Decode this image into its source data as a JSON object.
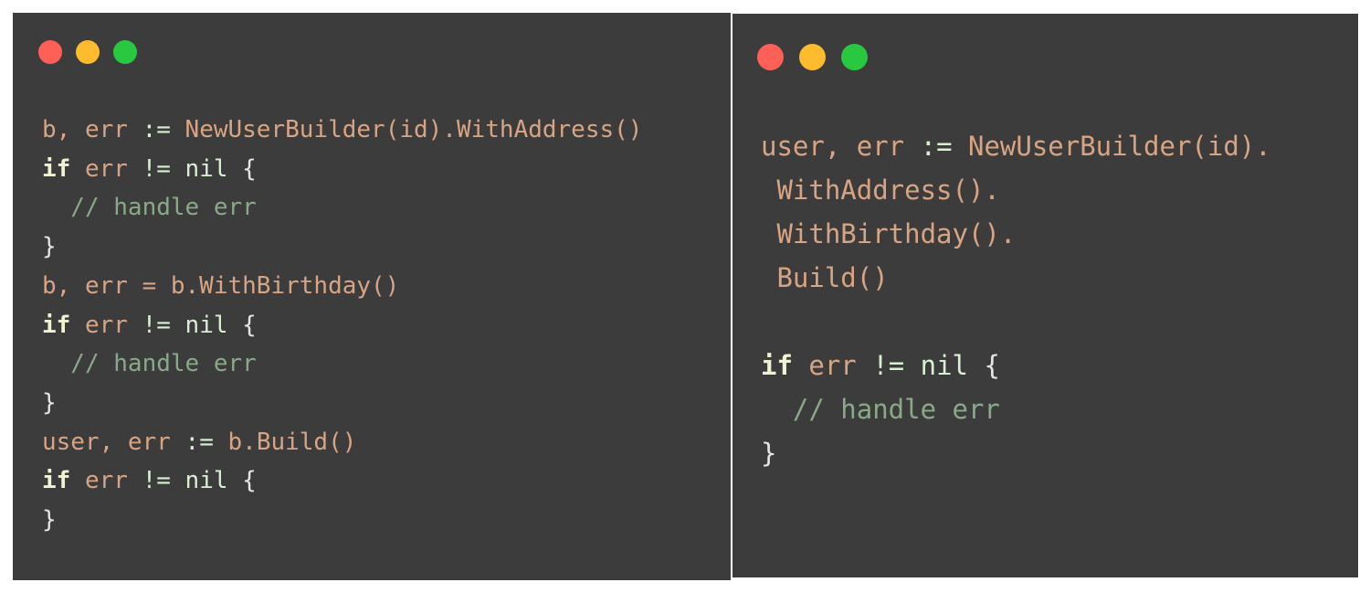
{
  "colors": {
    "window_bg": "#3c3c3c",
    "dot_red": "#fe5f57",
    "dot_yellow": "#fdbb2e",
    "dot_green": "#28c840",
    "identifier": "#d8a483",
    "keyword": "#f1f1d4",
    "operator": "#d8efd2",
    "comment": "#8aa989"
  },
  "windows": [
    {
      "id": "left",
      "lines": [
        [
          {
            "t": "b, err ",
            "k": "id"
          },
          {
            "t": ":=",
            "k": "op"
          },
          {
            "t": " NewUserBuilder(id).WithAddress()",
            "k": "id"
          }
        ],
        [
          {
            "t": "if",
            "k": "kw"
          },
          {
            "t": " err ",
            "k": "id"
          },
          {
            "t": "!=",
            "k": "op"
          },
          {
            "t": " nil",
            "k": "op"
          },
          {
            "t": " {",
            "k": "pn"
          }
        ],
        [
          {
            "t": "  // handle err",
            "k": "cm"
          }
        ],
        [
          {
            "t": "}",
            "k": "pn"
          }
        ],
        [
          {
            "t": "b, err = b.WithBirthday()",
            "k": "id"
          }
        ],
        [
          {
            "t": "if",
            "k": "kw"
          },
          {
            "t": " err ",
            "k": "id"
          },
          {
            "t": "!=",
            "k": "op"
          },
          {
            "t": " nil",
            "k": "op"
          },
          {
            "t": " {",
            "k": "pn"
          }
        ],
        [
          {
            "t": "  // handle err",
            "k": "cm"
          }
        ],
        [
          {
            "t": "}",
            "k": "pn"
          }
        ],
        [
          {
            "t": "user, err ",
            "k": "id"
          },
          {
            "t": ":=",
            "k": "op"
          },
          {
            "t": " b.Build()",
            "k": "id"
          }
        ],
        [
          {
            "t": "if",
            "k": "kw"
          },
          {
            "t": " err ",
            "k": "id"
          },
          {
            "t": "!=",
            "k": "op"
          },
          {
            "t": " nil",
            "k": "op"
          },
          {
            "t": " {",
            "k": "pn"
          }
        ],
        [
          {
            "t": "}",
            "k": "pn"
          }
        ]
      ]
    },
    {
      "id": "right",
      "lines": [
        [
          {
            "t": "user, err ",
            "k": "id"
          },
          {
            "t": ":=",
            "k": "op"
          },
          {
            "t": " NewUserBuilder(id).",
            "k": "id"
          }
        ],
        [
          {
            "t": " WithAddress().",
            "k": "id"
          }
        ],
        [
          {
            "t": " WithBirthday().",
            "k": "id"
          }
        ],
        [
          {
            "t": " Build()",
            "k": "id"
          }
        ],
        [
          {
            "t": "",
            "k": "id"
          }
        ],
        [
          {
            "t": "if",
            "k": "kw"
          },
          {
            "t": " err ",
            "k": "id"
          },
          {
            "t": "!=",
            "k": "op"
          },
          {
            "t": " nil",
            "k": "op"
          },
          {
            "t": " {",
            "k": "pn"
          }
        ],
        [
          {
            "t": "  // handle err",
            "k": "cm"
          }
        ],
        [
          {
            "t": "}",
            "k": "pn"
          }
        ]
      ]
    }
  ]
}
